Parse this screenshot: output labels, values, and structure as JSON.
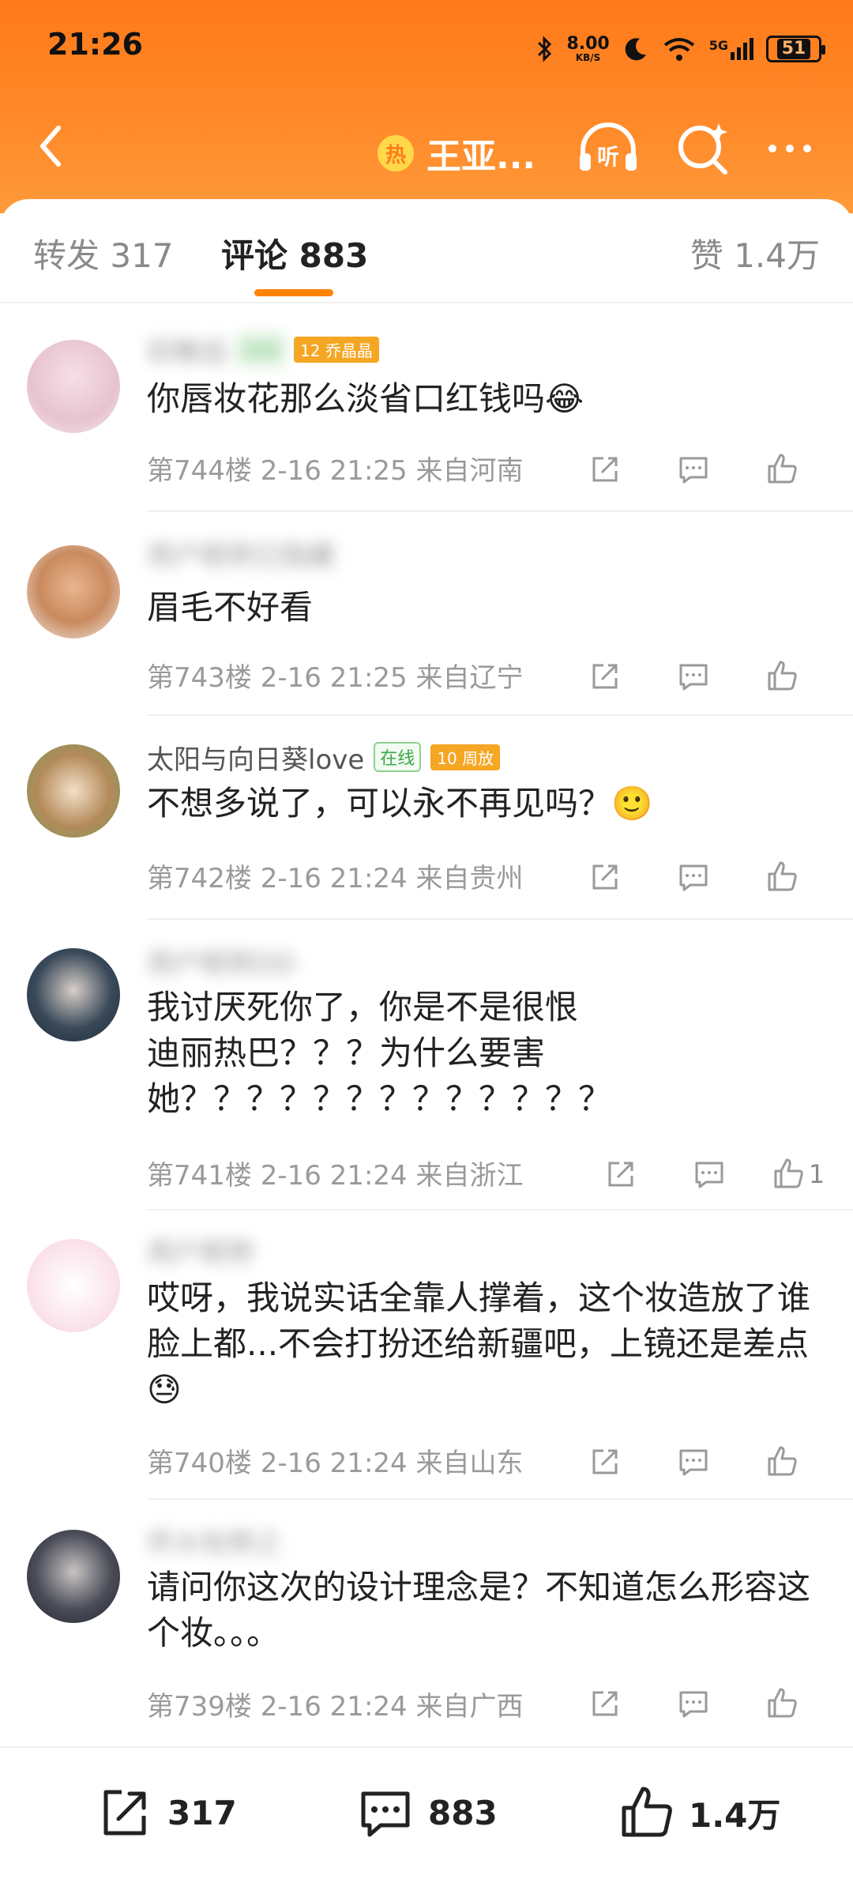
{
  "status": {
    "time": "21:26",
    "net_speed": "8.00",
    "net_unit": "KB/S",
    "network": "5G",
    "battery": "51"
  },
  "nav": {
    "hot_label": "热",
    "title": "王亚..."
  },
  "tabs": {
    "repost": "转发 317",
    "comments": "评论 883",
    "likes": "赞 1.4万"
  },
  "comments": [
    {
      "username": "初稚齿",
      "online": "在线",
      "fan_badge": "12 乔晶晶",
      "text": "你唇妆花那么淡省口红钱吗😂",
      "meta": "第744楼  2-16 21:25  来自河南",
      "like_count": ""
    },
    {
      "username": "用户昵称已隐藏",
      "online": "",
      "fan_badge": "",
      "text": "眉毛不好看",
      "meta": "第743楼  2-16 21:25  来自辽宁",
      "like_count": ""
    },
    {
      "username": "太阳与向日葵love",
      "online": "在线",
      "fan_badge": "10 周放",
      "text": "不想多说了，可以永不再见吗？🙂",
      "meta": "第742楼  2-16 21:24  来自贵州",
      "like_count": ""
    },
    {
      "username": "用户昵称DD",
      "online": "",
      "fan_badge": "",
      "text": "我讨厌死你了，你是不是很恨\n迪丽热巴？？？为什么要害\n她？？？？？？？？？？？？？",
      "meta": "第741楼  2-16 21:24  来自浙江",
      "like_count": "1"
    },
    {
      "username": "用户昵称",
      "online": "",
      "fan_badge": "",
      "text": "哎呀，我说实话全靠人撑着，这个妆造放了谁脸上都...不会打扮还给新疆吧，上镜还是差点😓",
      "meta": "第740楼  2-16 21:24  来自山东",
      "like_count": ""
    },
    {
      "username": "乔大旬悍之",
      "online": "",
      "fan_badge": "",
      "text": "请问你这次的设计理念是？不知道怎么形容这个妆。。。",
      "meta": "第739楼  2-16 21:24  来自广西",
      "like_count": ""
    }
  ],
  "bottom": {
    "repost": "317",
    "comment": "883",
    "like": "1.4万"
  },
  "colors": {
    "accent": "#ff8200",
    "header": "#ff7a1a"
  }
}
